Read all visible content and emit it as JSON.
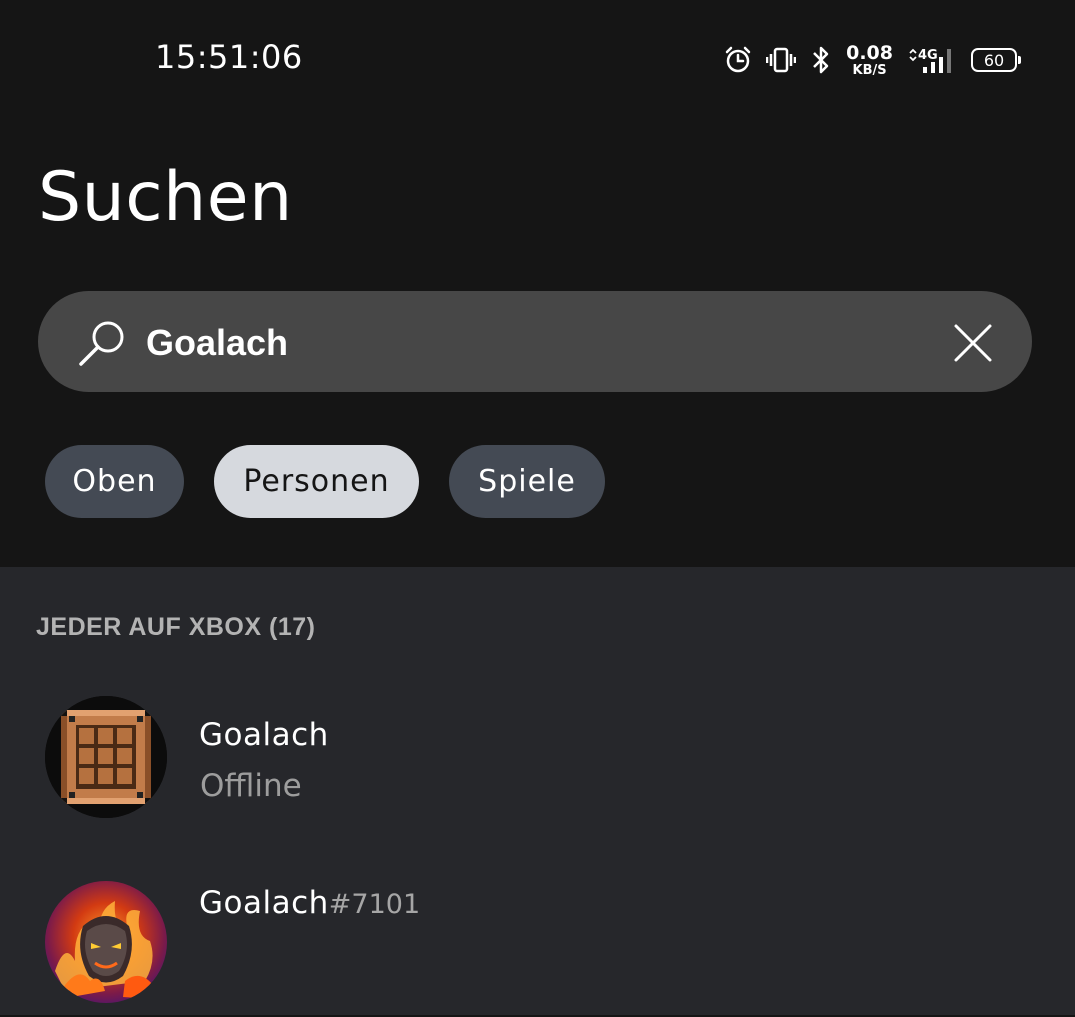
{
  "status_bar": {
    "time": "15:51:06",
    "speed_value": "0.08",
    "speed_unit": "KB/S",
    "network": "4G",
    "battery": "60"
  },
  "page": {
    "title": "Suchen"
  },
  "search": {
    "value": "Goalach"
  },
  "filters": {
    "items": [
      {
        "label": "Oben",
        "selected": false
      },
      {
        "label": "Personen",
        "selected": true
      },
      {
        "label": "Spiele",
        "selected": false
      }
    ]
  },
  "results": {
    "section_title": "JEDER AUF XBOX (17)",
    "people": [
      {
        "gamertag": "Goalach",
        "suffix": "",
        "presence": "Offline",
        "avatar": "crafting-table-icon"
      },
      {
        "gamertag": "Goalach",
        "suffix": "#7101",
        "presence": "",
        "avatar": "fire-demon-avatar"
      }
    ]
  },
  "colors": {
    "background": "#151515",
    "search_bar": "#474747",
    "chip_inactive": "#444a54",
    "chip_active": "#d6d9de",
    "results_background": "#26272b"
  }
}
